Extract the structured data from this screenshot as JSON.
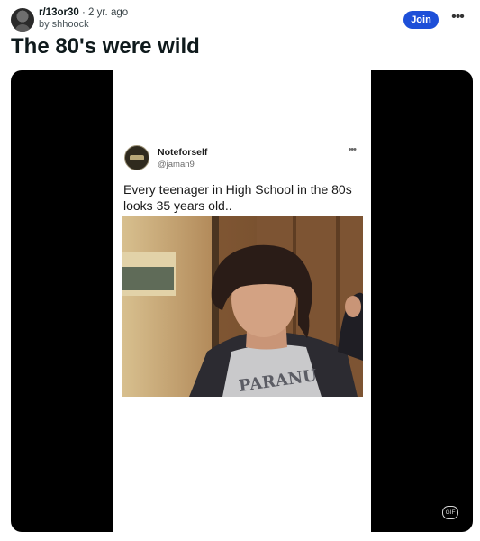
{
  "post": {
    "subreddit": "r/13or30",
    "separator": "·",
    "time_ago": "2 yr. ago",
    "byline": "by shhoock",
    "title": "The 80's were wild",
    "join_label": "Join",
    "more_label": "•••"
  },
  "media": {
    "gif_badge": "GIF",
    "tweet": {
      "name": "Noteforself",
      "handle": "@jaman9",
      "more_label": "•••",
      "text": "Every teenager in High School in the 80s looks 35 years old..",
      "shirt_text": "PARANU"
    }
  }
}
